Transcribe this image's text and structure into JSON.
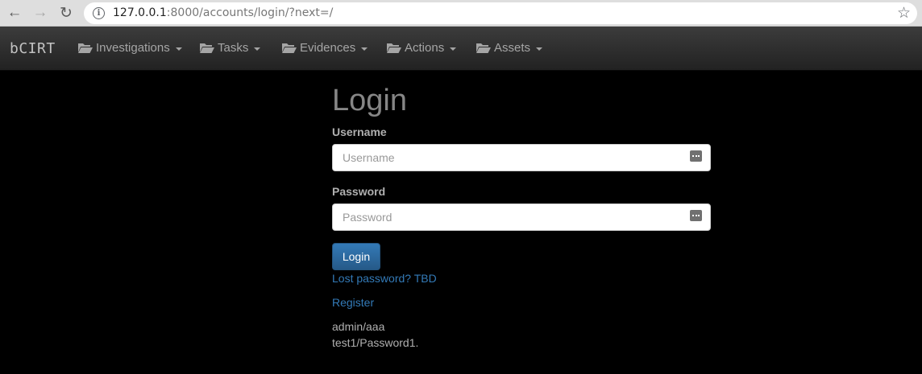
{
  "browser": {
    "url_host": "127.0.0.1",
    "url_rest": ":8000/accounts/login/?next=/"
  },
  "navbar": {
    "brand": "bCIRT",
    "menus": [
      {
        "label": "Investigations",
        "icon": "folder-open-icon"
      },
      {
        "label": "Tasks",
        "icon": "folder-open-icon"
      },
      {
        "label": "Evidences",
        "icon": "folder-open-icon"
      },
      {
        "label": "Actions",
        "icon": "folder-open-icon"
      },
      {
        "label": "Assets",
        "icon": "folder-open-icon"
      }
    ]
  },
  "login": {
    "title": "Login",
    "username_label": "Username",
    "username_placeholder": "Username",
    "password_label": "Password",
    "password_placeholder": "Password",
    "submit_label": "Login",
    "lost_password_link": "Lost password? TBD",
    "register_link": "Register",
    "notes": [
      "admin/aaa",
      "test1/Password1."
    ]
  },
  "colors": {
    "page_bg": "#000000",
    "navbar_bg": "#2b2b2b",
    "link": "#337ab7",
    "button_primary": "#337ab7"
  }
}
